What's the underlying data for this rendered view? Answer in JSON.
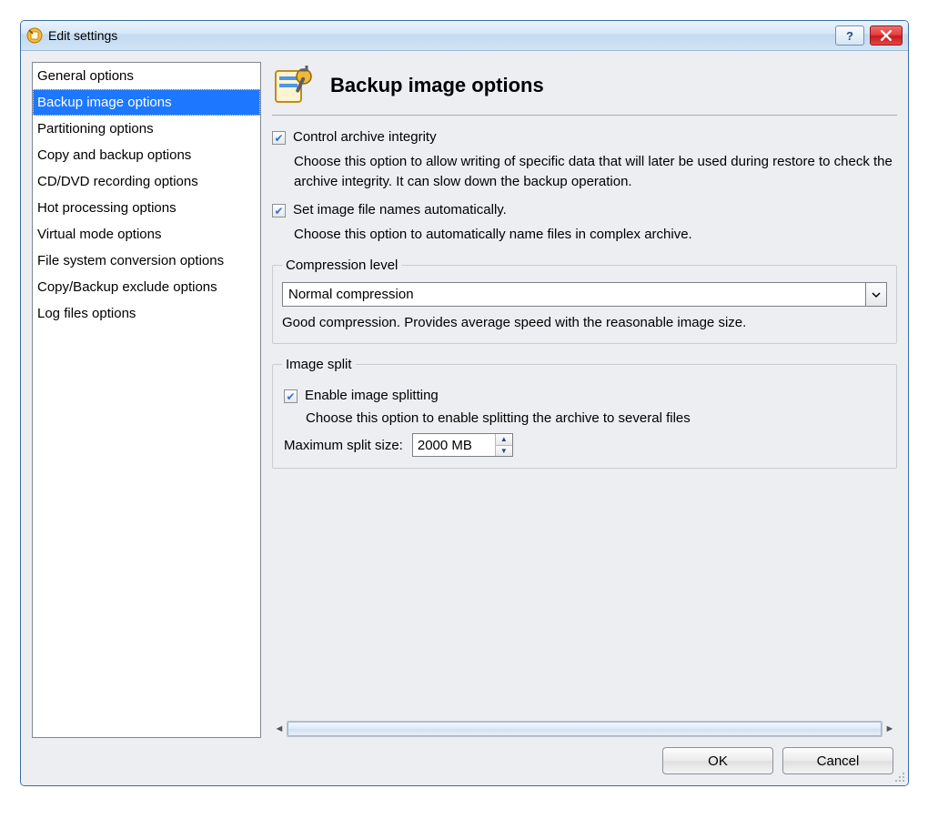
{
  "window": {
    "title": "Edit settings"
  },
  "sidebar": {
    "items": [
      {
        "label": "General options"
      },
      {
        "label": "Backup image options"
      },
      {
        "label": "Partitioning options"
      },
      {
        "label": "Copy and backup options"
      },
      {
        "label": "CD/DVD recording options"
      },
      {
        "label": "Hot processing options"
      },
      {
        "label": "Virtual mode options"
      },
      {
        "label": "File system conversion options"
      },
      {
        "label": "Copy/Backup exclude options"
      },
      {
        "label": "Log files options"
      }
    ],
    "selected_index": 1
  },
  "page": {
    "title": "Backup image options",
    "opt1": {
      "label": "Control archive integrity",
      "checked": true,
      "desc": "Choose this option to allow writing of specific data that will later be used during restore to check the archive integrity. It can slow down the backup operation."
    },
    "opt2": {
      "label": "Set image file names automatically.",
      "checked": true,
      "desc": "Choose this option to automatically name files in complex archive."
    },
    "compression": {
      "legend": "Compression level",
      "value": "Normal compression",
      "hint": "Good compression. Provides average speed with the reasonable image size."
    },
    "split": {
      "legend": "Image split",
      "enable_label": "Enable image splitting",
      "enable_checked": true,
      "enable_desc": "Choose this option to enable splitting the archive to several files",
      "max_label": "Maximum split size:",
      "max_value": "2000 MB"
    }
  },
  "buttons": {
    "ok": "OK",
    "cancel": "Cancel"
  }
}
